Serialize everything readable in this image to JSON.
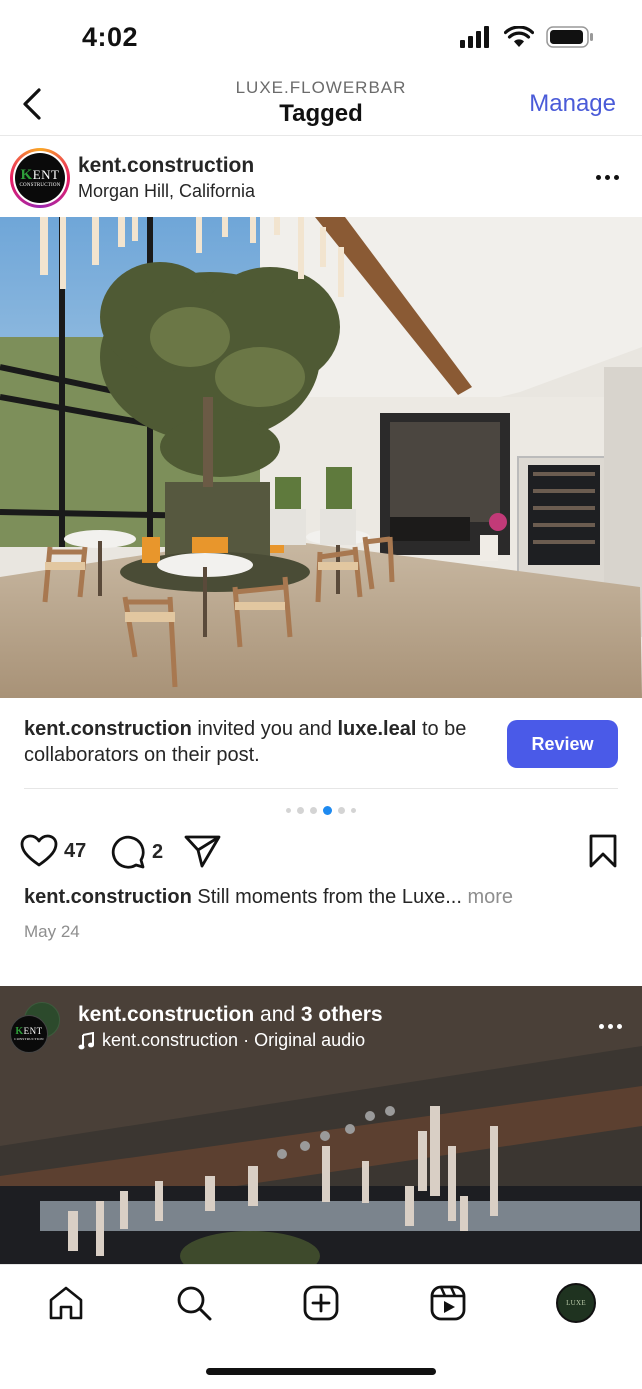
{
  "status_bar": {
    "time": "4:02"
  },
  "nav": {
    "subtitle": "LUXE.FLOWERBAR",
    "title": "Tagged",
    "manage_label": "Manage"
  },
  "post": {
    "username": "kent.construction",
    "location": "Morgan Hill, California",
    "avatar_logo": {
      "letters": "ENT",
      "first_letter": "K",
      "tagline": "CONSTRUCTION"
    },
    "collab": {
      "inviter": "kent.construction",
      "text_1": " invited you and ",
      "other_user": "luxe.leal",
      "text_2": " to be collaborators on their post.",
      "review_label": "Review"
    },
    "carousel": {
      "count": 6,
      "active_index": 3
    },
    "likes": "47",
    "comments": "2",
    "caption_user": "kent.construction",
    "caption_text": " Still moments from the Luxe...",
    "caption_more": " more",
    "date": "May 24"
  },
  "reel": {
    "username": "kent.construction",
    "and_text": " and ",
    "others": "3 others",
    "audio": "kent.construction · Original audio"
  },
  "tab_bar": {
    "items": [
      "home-icon",
      "search-icon",
      "create-icon",
      "reels-icon",
      "profile-avatar"
    ],
    "profile_label": "LUXE"
  },
  "colors": {
    "accent": "#4a5ae8",
    "manage": "#4a5bd8",
    "carousel_active": "#1e8af0"
  }
}
